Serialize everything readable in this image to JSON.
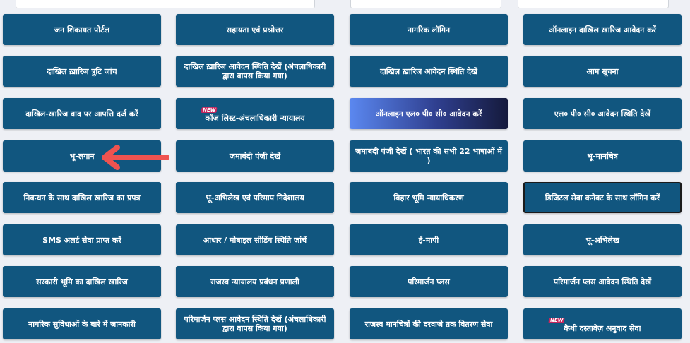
{
  "colors": {
    "button_bg": "#11567f",
    "page_bg": "#eef0f5",
    "arrow": "#ef5350",
    "badge": "#c4275e"
  },
  "badge_text": "NEW",
  "rows": [
    [
      "जन शिकायत पोर्टल",
      "सहायता एवं प्रश्नोत्तर",
      "नागरिक लॉगिन",
      "ऑनलाइन दाखिल ख़ारिज आवेदन करें"
    ],
    [
      "दाखिल ख़ारिज त्रुटि जांच",
      "दाखिल ख़ारिज आवेदन स्थिति देखें (अंचलाधिकारी द्वारा वापस किया गया)",
      "दाखिल ख़ारिज आवेदन स्थिति देखें",
      "आम सूचना"
    ],
    [
      "दाखिल-खारिज वाद पर आपत्ति दर्ज करें",
      "कॉज लिस्ट-अंचलाधिकारी न्यायालय",
      "ऑनलाइन एल० पी० सी० आवेदन करें",
      "एल० पी० सी० आवेदन स्थिति देखें"
    ],
    [
      "भू-लगान",
      "जमाबंदी पंजी देखें",
      "जमाबंदी पंजी देखें ( भारत की सभी 22 भाषाओं में )",
      "भू-मानचित्र"
    ],
    [
      "निबन्धन के साथ दाखिल ख़ारिज का प्रपत्र",
      "भू-अभिलेख एवं परिमाप निदेशालय",
      "बिहार भूमि न्यायाधिकरण",
      "डिजिटल सेवा कनेक्ट के साथ लॉगिन करें"
    ],
    [
      "SMS अलर्ट सेवा प्राप्त करें",
      "आधार / मोबाइल सीडिंग स्थिति जांचें",
      "ई-मापी",
      "भू-अभिलेख"
    ],
    [
      "सरकारी भूमि का दाखिल ख़ारिज",
      "राजस्व न्यायालय प्रबंधन प्रणाली",
      "परिमार्जन प्लस",
      "परिमार्जन प्लस आवेदन स्थिति देखें"
    ],
    [
      "नागरिक सुविधाओं के बारे में जानकारी",
      "परिमार्जन प्लस आवेदन स्थिति देखें (अंचलाधिकारी द्वारा वापस किया गया)",
      "राजस्व मानचित्रों की दरवाजे तक वितरण सेवा",
      "कैथी दस्तावेज़ अनुवाद सेवा"
    ]
  ]
}
